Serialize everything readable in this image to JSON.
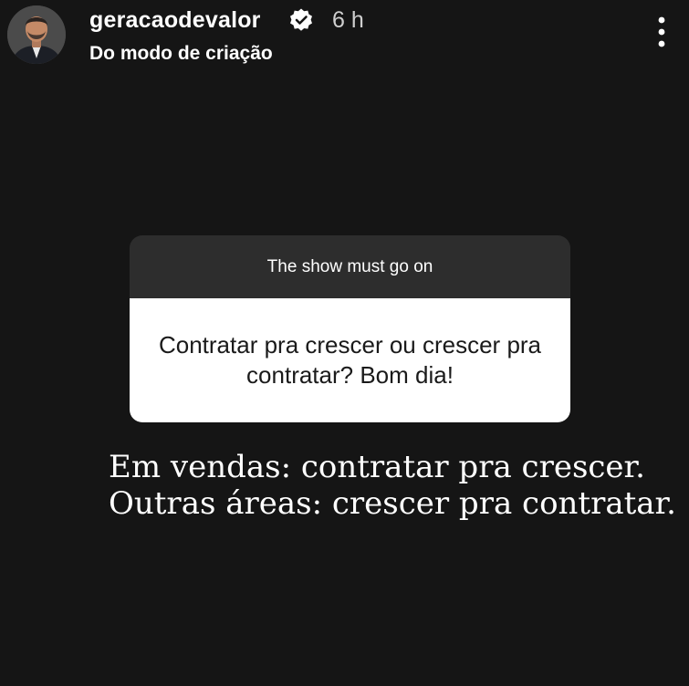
{
  "header": {
    "avatar_icon": "avatar-photo",
    "username": "geracaodevalor",
    "verified_icon": "verified-badge-icon",
    "time": "6 h",
    "subtitle": "Do modo de criação",
    "more_icon": "more-vertical-icon"
  },
  "question_card": {
    "title": "The show must go on",
    "question": "Contratar pra crescer ou crescer pra contratar? Bom dia!"
  },
  "answer": {
    "line1": "Em vendas: contratar pra crescer.",
    "line2": "Outras áreas: crescer pra contratar."
  },
  "colors": {
    "background": "#151515",
    "card_header": "#2d2d2d",
    "card_body": "#ffffff"
  }
}
